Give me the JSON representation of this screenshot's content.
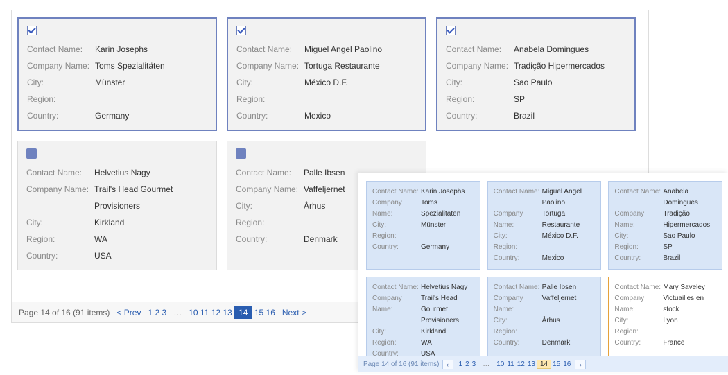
{
  "labels": {
    "contact": "Contact Name:",
    "company": "Company Name:",
    "city": "City:",
    "region": "Region:",
    "country": "Country:"
  },
  "back": {
    "rows": [
      [
        {
          "checked": true,
          "contact": "Karin Josephs",
          "company": "Toms Spezialitäten",
          "city": "Münster",
          "region": "",
          "country": "Germany"
        },
        {
          "checked": true,
          "contact": "Miguel Angel Paolino",
          "company": "Tortuga Restaurante",
          "city": "México D.F.",
          "region": "",
          "country": "Mexico"
        },
        {
          "checked": true,
          "contact": "Anabela Domingues",
          "company": "Tradição Hipermercados",
          "city": "Sao Paulo",
          "region": "SP",
          "country": "Brazil"
        }
      ],
      [
        {
          "checked": false,
          "contact": "Helvetius Nagy",
          "company": "Trail's Head Gourmet Provisioners",
          "city": "Kirkland",
          "region": "WA",
          "country": "USA"
        },
        {
          "checked": false,
          "contact": "Palle Ibsen",
          "company": "Vaffeljernet",
          "city": "Århus",
          "region": "",
          "country": "Denmark"
        }
      ]
    ],
    "pager": {
      "summary": "Page 14 of 16 (91 items)",
      "prev": "< Prev",
      "next": "Next >",
      "pages_left": [
        "1",
        "2",
        "3"
      ],
      "pages_right": [
        "10",
        "11",
        "12",
        "13",
        "14",
        "15",
        "16"
      ],
      "current": "14"
    }
  },
  "front": {
    "rows": [
      [
        {
          "sel": true,
          "foc": false,
          "contact": "Karin Josephs",
          "company": "Toms Spezialitäten",
          "city": "Münster",
          "region": "",
          "country": "Germany"
        },
        {
          "sel": true,
          "foc": false,
          "contact": "Miguel Angel Paolino",
          "company": "Tortuga Restaurante",
          "city": "México D.F.",
          "region": "",
          "country": "Mexico"
        },
        {
          "sel": true,
          "foc": false,
          "contact": "Anabela Domingues",
          "company": "Tradição Hipermercados",
          "city": "Sao Paulo",
          "region": "SP",
          "country": "Brazil"
        }
      ],
      [
        {
          "sel": true,
          "foc": false,
          "contact": "Helvetius Nagy",
          "company": "Trail's Head Gourmet Provisioners",
          "city": "Kirkland",
          "region": "WA",
          "country": "USA"
        },
        {
          "sel": true,
          "foc": false,
          "contact": "Palle Ibsen",
          "company": "Vaffeljernet",
          "city": "Århus",
          "region": "",
          "country": "Denmark"
        },
        {
          "sel": false,
          "foc": true,
          "contact": "Mary Saveley",
          "company": "Victuailles en stock",
          "city": "Lyon",
          "region": "",
          "country": "France"
        }
      ]
    ],
    "pager": {
      "summary": "Page 14 of 16 (91 items)",
      "prev": "‹",
      "next": "›",
      "pages_left": [
        "1",
        "2",
        "3"
      ],
      "pages_right": [
        "10",
        "11",
        "12",
        "13",
        "14",
        "15",
        "16"
      ],
      "current": "14"
    }
  }
}
